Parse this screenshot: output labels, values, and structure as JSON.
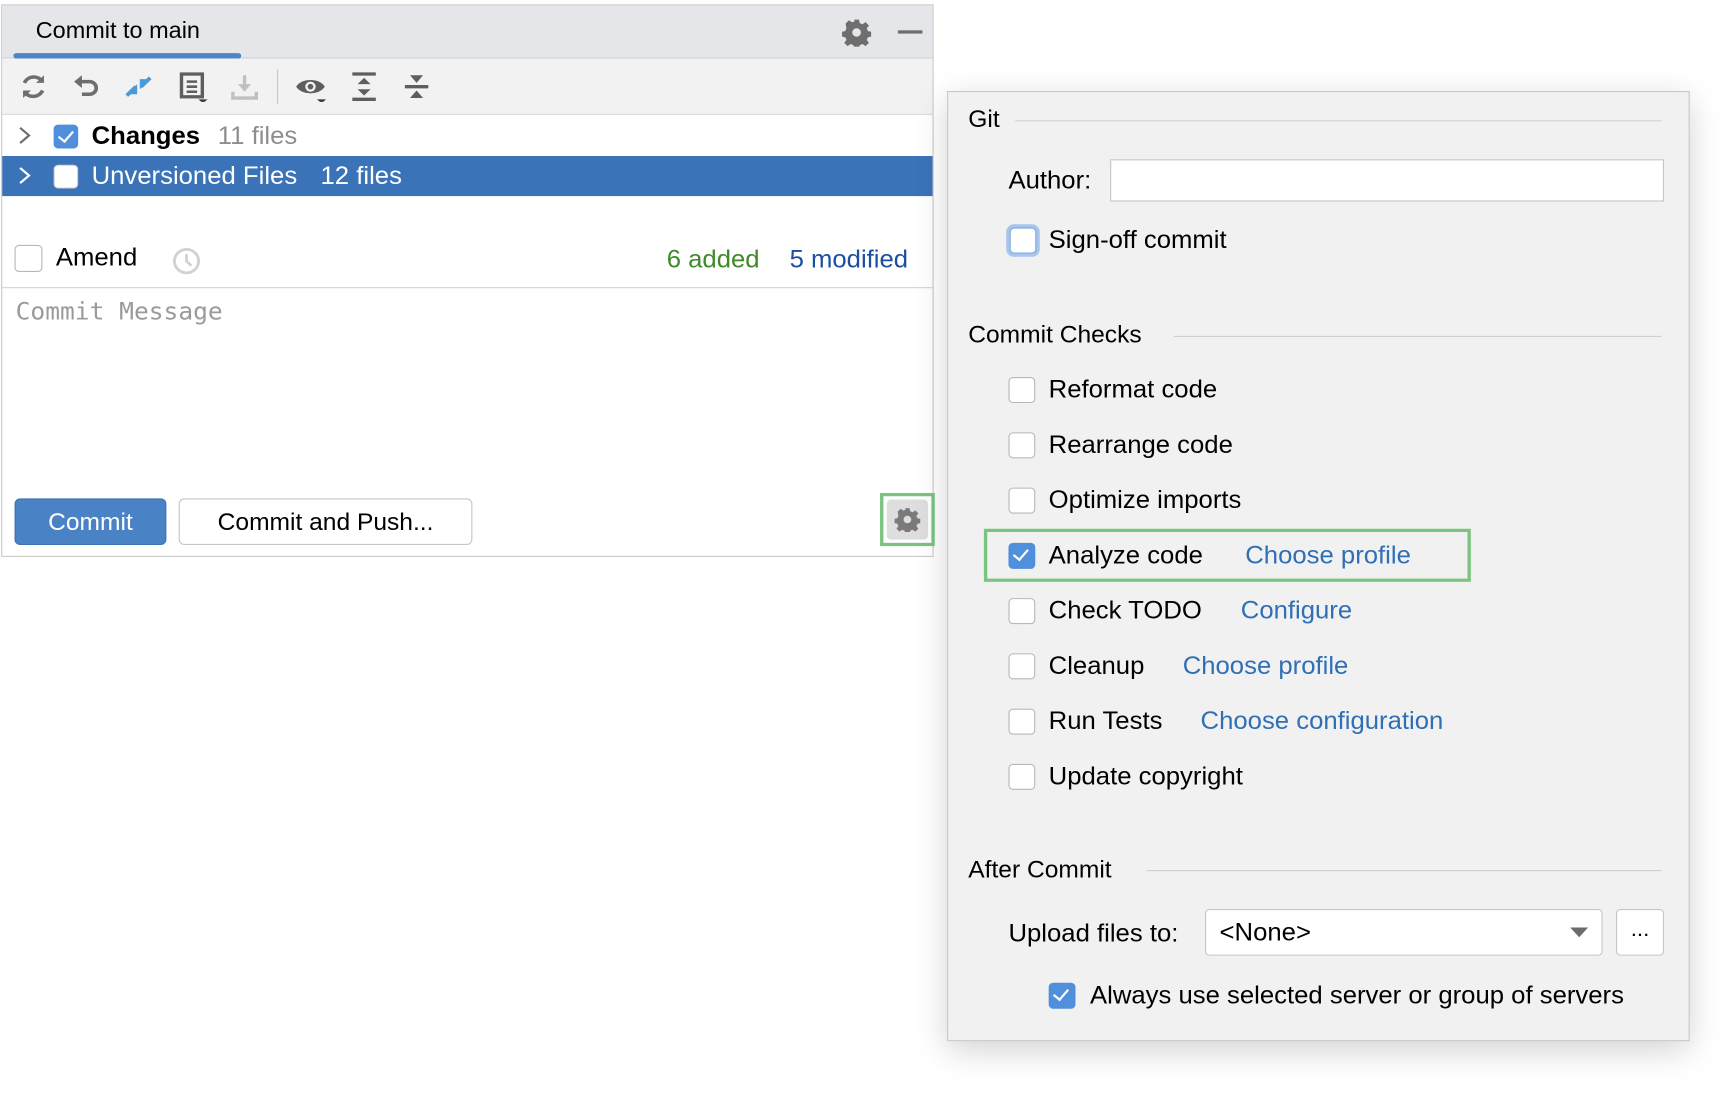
{
  "commit_panel": {
    "tab_title": "Commit to main",
    "header_icons": [
      "gear-icon",
      "minimize-icon"
    ],
    "toolbar": {
      "icons": [
        "refresh-icon",
        "rollback-icon",
        "show-diff-icon",
        "changelist-icon",
        "shelve-icon",
        "view-options-icon",
        "expand-all-icon",
        "collapse-all-icon"
      ]
    },
    "tree": [
      {
        "label": "Changes",
        "count": "11 files",
        "checked": true,
        "selected": false
      },
      {
        "label": "Unversioned Files",
        "count": "12 files",
        "checked": false,
        "selected": true
      }
    ],
    "amend_label": "Amend",
    "stats": {
      "added": "6 added",
      "modified": "5 modified",
      "added_color": "#3e8a28",
      "modified_color": "#1b4fa0"
    },
    "commit_message_placeholder": "Commit Message",
    "buttons": {
      "commit": "Commit",
      "commit_and_push": "Commit and Push..."
    }
  },
  "options_popup": {
    "git_section": {
      "title": "Git",
      "author_label": "Author:",
      "author_value": "",
      "signoff_label": "Sign-off commit",
      "signoff_checked": false
    },
    "commit_checks": {
      "title": "Commit Checks",
      "items": [
        {
          "label": "Reformat code",
          "checked": false,
          "link": ""
        },
        {
          "label": "Rearrange code",
          "checked": false,
          "link": ""
        },
        {
          "label": "Optimize imports",
          "checked": false,
          "link": ""
        },
        {
          "label": "Analyze code",
          "checked": true,
          "link": "Choose profile"
        },
        {
          "label": "Check TODO",
          "checked": false,
          "link": "Configure"
        },
        {
          "label": "Cleanup",
          "checked": false,
          "link": "Choose profile"
        },
        {
          "label": "Run Tests",
          "checked": false,
          "link": "Choose configuration"
        },
        {
          "label": "Update copyright",
          "checked": false,
          "link": ""
        }
      ]
    },
    "after_commit": {
      "title": "After Commit",
      "upload_label": "Upload files to:",
      "upload_value": "<None>",
      "ellipsis_label": "...",
      "always_use_label": "Always use selected server or group of servers",
      "always_use_checked": true
    }
  },
  "colors": {
    "accent": "#4a82c6",
    "selection": "#3b73b9",
    "link": "#2f6fb5",
    "highlight_border": "#7bc47f"
  }
}
